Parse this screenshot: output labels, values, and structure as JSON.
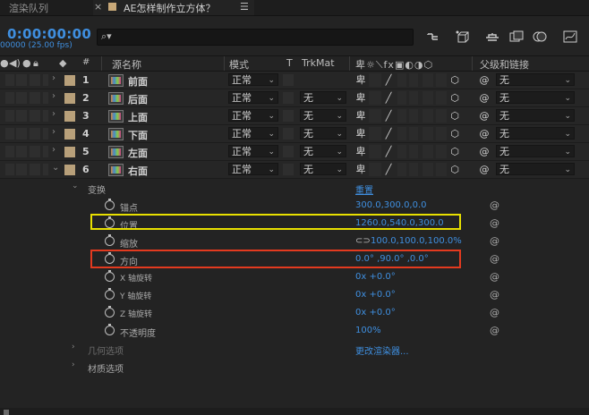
{
  "tabs": {
    "render_queue": "渲染队列",
    "close": "×",
    "active": "AE怎样制作立方体？",
    "menu": "☰"
  },
  "header": {
    "timecode": "0:00:00:00",
    "fps": "00000 (25.00 fps)",
    "search_placeholder": "",
    "search_icon": "search-icon"
  },
  "columns": {
    "hash": "#",
    "source_name": "源名称",
    "mode": "模式",
    "t": "T",
    "trkmat": "TrkMat",
    "parent": "父级和链接"
  },
  "layers": [
    {
      "num": "1",
      "name": "前面",
      "mode": "正常",
      "trkmat": "",
      "parent": "无"
    },
    {
      "num": "2",
      "name": "后面",
      "mode": "正常",
      "trkmat": "无",
      "parent": "无"
    },
    {
      "num": "3",
      "name": "上面",
      "mode": "正常",
      "trkmat": "无",
      "parent": "无"
    },
    {
      "num": "4",
      "name": "下面",
      "mode": "正常",
      "trkmat": "无",
      "parent": "无"
    },
    {
      "num": "5",
      "name": "左面",
      "mode": "正常",
      "trkmat": "无",
      "parent": "无"
    },
    {
      "num": "6",
      "name": "右面",
      "mode": "正常",
      "trkmat": "无",
      "parent": "无"
    }
  ],
  "transform": {
    "label": "变换",
    "reset": "重置",
    "props": [
      {
        "name": "锚点",
        "value": "300.0,300.0,0.0"
      },
      {
        "name": "位置",
        "value": "1260.0,540.0,300.0"
      },
      {
        "name": "缩放",
        "value": "100.0,100.0,100.0%"
      },
      {
        "name": "方向",
        "value": "0.0° ,90.0° ,0.0°"
      },
      {
        "name": "X 轴旋转",
        "value": "0x +0.0°"
      },
      {
        "name": "Y 轴旋转",
        "value": "0x +0.0°"
      },
      {
        "name": "Z 轴旋转",
        "value": "0x +0.0°"
      },
      {
        "name": "不透明度",
        "value": "100%"
      }
    ]
  },
  "geometry": {
    "label": "几何选项",
    "value": "更改渲染器..."
  },
  "material": {
    "label": "材质选项"
  },
  "colors": {
    "accent": "#3f8fe0",
    "label": "#b8a07a",
    "highlight_yellow": "#e8e000",
    "highlight_red": "#e33a1f"
  }
}
